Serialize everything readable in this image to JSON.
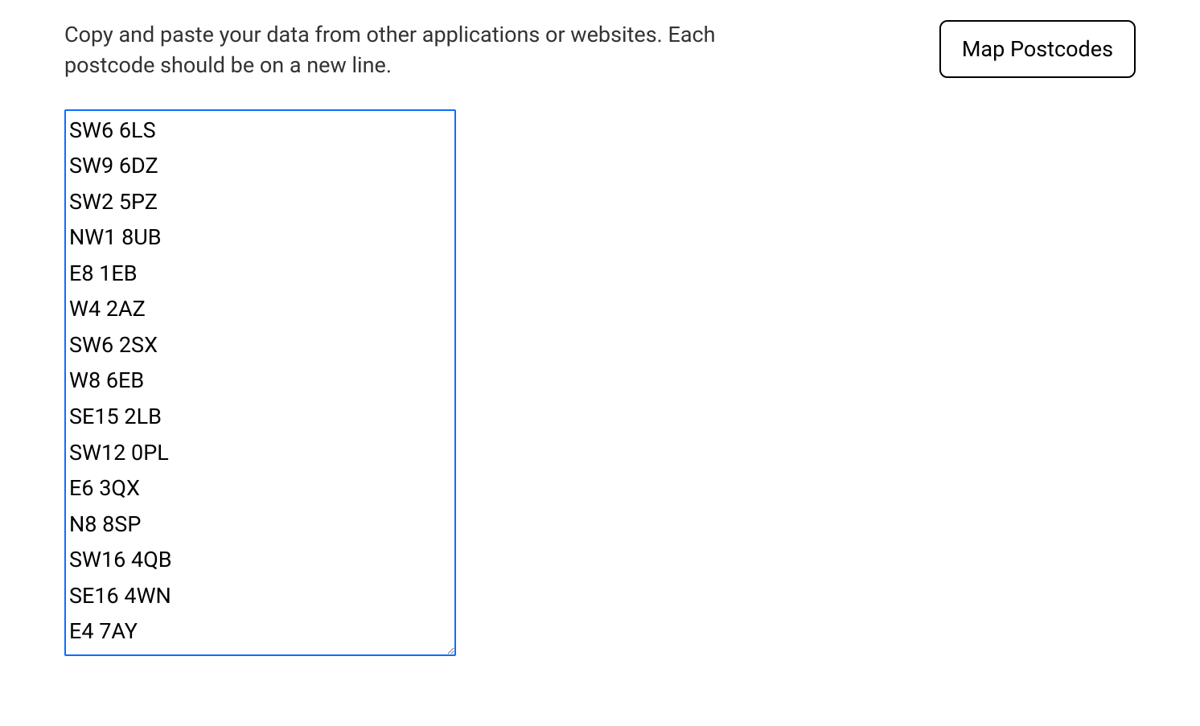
{
  "instructions": "Copy and paste your data from other applications or websites. Each postcode should be on a new line.",
  "textarea": {
    "value": "SW6 6LS\nSW9 6DZ\nSW2 5PZ\nNW1 8UB\nE8 1EB\nW4 2AZ\nSW6 2SX\nW8 6EB\nSE15 2LB\nSW12 0PL\nE6 3QX\nN8 8SP\nSW16 4QB\nSE16 4WN\nE4 7AY"
  },
  "button": {
    "label": "Map Postcodes"
  }
}
